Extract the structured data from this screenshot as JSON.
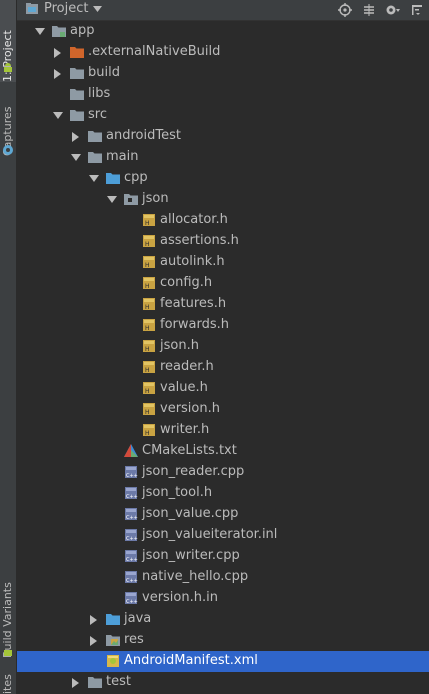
{
  "toolwindow": {
    "left_tabs": [
      "1: Project",
      "Captures",
      "Build Variants",
      "ites"
    ],
    "header": {
      "title": "Project",
      "icons": [
        "target-icon",
        "collapse-icon",
        "gear-icon",
        "hide-icon"
      ]
    }
  },
  "tree": {
    "rows": [
      {
        "label": "app",
        "depth": 0,
        "expanded": true,
        "icon": "module-folder-icon"
      },
      {
        "label": ".externalNativeBuild",
        "depth": 1,
        "expanded": false,
        "icon": "excluded-folder-icon"
      },
      {
        "label": "build",
        "depth": 1,
        "expanded": false,
        "icon": "folder-icon"
      },
      {
        "label": "libs",
        "depth": 1,
        "icon": "folder-icon"
      },
      {
        "label": "src",
        "depth": 1,
        "expanded": true,
        "icon": "folder-icon"
      },
      {
        "label": "androidTest",
        "depth": 2,
        "expanded": false,
        "icon": "folder-icon"
      },
      {
        "label": "main",
        "depth": 2,
        "expanded": true,
        "icon": "folder-icon"
      },
      {
        "label": "cpp",
        "depth": 3,
        "expanded": true,
        "icon": "source-folder-icon"
      },
      {
        "label": "json",
        "depth": 4,
        "expanded": true,
        "icon": "package-icon"
      },
      {
        "label": "allocator.h",
        "depth": 5,
        "icon": "header-file-icon"
      },
      {
        "label": "assertions.h",
        "depth": 5,
        "icon": "header-file-icon"
      },
      {
        "label": "autolink.h",
        "depth": 5,
        "icon": "header-file-icon"
      },
      {
        "label": "config.h",
        "depth": 5,
        "icon": "header-file-icon"
      },
      {
        "label": "features.h",
        "depth": 5,
        "icon": "header-file-icon"
      },
      {
        "label": "forwards.h",
        "depth": 5,
        "icon": "header-file-icon"
      },
      {
        "label": "json.h",
        "depth": 5,
        "icon": "header-file-icon"
      },
      {
        "label": "reader.h",
        "depth": 5,
        "icon": "header-file-icon"
      },
      {
        "label": "value.h",
        "depth": 5,
        "icon": "header-file-icon"
      },
      {
        "label": "version.h",
        "depth": 5,
        "icon": "header-file-icon"
      },
      {
        "label": "writer.h",
        "depth": 5,
        "icon": "header-file-icon"
      },
      {
        "label": "CMakeLists.txt",
        "depth": 4,
        "icon": "cmake-icon"
      },
      {
        "label": "json_reader.cpp",
        "depth": 4,
        "icon": "cpp-file-icon"
      },
      {
        "label": "json_tool.h",
        "depth": 4,
        "icon": "cpp-file-icon"
      },
      {
        "label": "json_value.cpp",
        "depth": 4,
        "icon": "cpp-file-icon"
      },
      {
        "label": "json_valueiterator.inl",
        "depth": 4,
        "icon": "cpp-file-icon"
      },
      {
        "label": "json_writer.cpp",
        "depth": 4,
        "icon": "cpp-file-icon"
      },
      {
        "label": "native_hello.cpp",
        "depth": 4,
        "icon": "cpp-file-icon"
      },
      {
        "label": "version.h.in",
        "depth": 4,
        "icon": "cpp-file-icon"
      },
      {
        "label": "java",
        "depth": 3,
        "expanded": false,
        "icon": "source-folder-icon"
      },
      {
        "label": "res",
        "depth": 3,
        "expanded": false,
        "icon": "res-folder-icon"
      },
      {
        "label": "AndroidManifest.xml",
        "depth": 3,
        "icon": "manifest-icon",
        "selected": true
      },
      {
        "label": "test",
        "depth": 2,
        "expanded": false,
        "icon": "folder-icon"
      }
    ]
  },
  "colors": {
    "background": "#2b2b2b",
    "panel": "#3c3f41",
    "selection": "#2f65ca",
    "text": "#bbbbbb",
    "folder": "#8e9aa4",
    "source_folder": "#4d9ed8",
    "excluded_folder": "#d0652b",
    "header_icon": "#c9a342",
    "cpp_icon": "#6c7aa8"
  }
}
